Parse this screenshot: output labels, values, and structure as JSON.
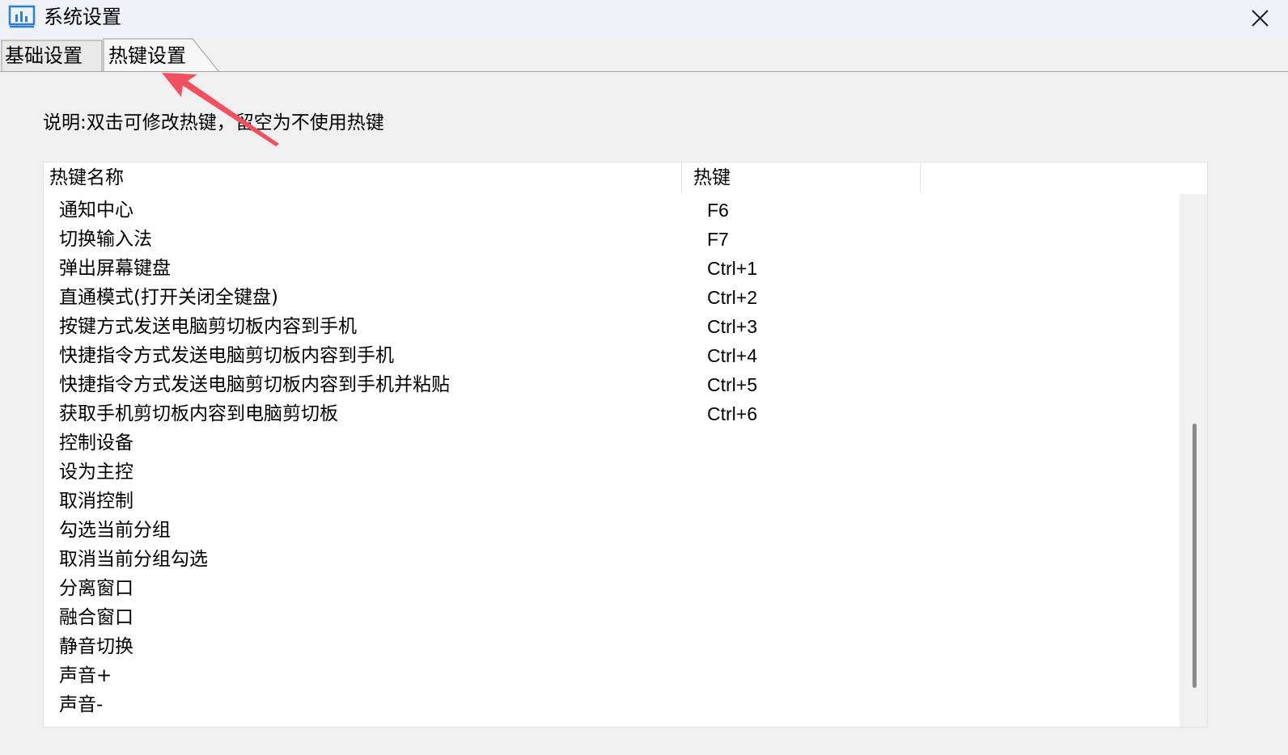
{
  "window": {
    "title": "系统设置"
  },
  "tabs": [
    {
      "label": "基础设置"
    },
    {
      "label": "热键设置"
    }
  ],
  "description": "说明:双击可修改热键，留空为不使用热键",
  "table": {
    "headers": {
      "name": "热键名称",
      "key": "热键"
    },
    "rows": [
      {
        "name": "通知中心",
        "key": "F6"
      },
      {
        "name": "切换输入法",
        "key": "F7"
      },
      {
        "name": "弹出屏幕键盘",
        "key": "Ctrl+1"
      },
      {
        "name": "直通模式(打开关闭全键盘)",
        "key": "Ctrl+2"
      },
      {
        "name": "按键方式发送电脑剪切板内容到手机",
        "key": "Ctrl+3"
      },
      {
        "name": "快捷指令方式发送电脑剪切板内容到手机",
        "key": "Ctrl+4"
      },
      {
        "name": "快捷指令方式发送电脑剪切板内容到手机并粘贴",
        "key": "Ctrl+5"
      },
      {
        "name": "获取手机剪切板内容到电脑剪切板",
        "key": "Ctrl+6"
      },
      {
        "name": "控制设备",
        "key": ""
      },
      {
        "name": "设为主控",
        "key": ""
      },
      {
        "name": "取消控制",
        "key": ""
      },
      {
        "name": "勾选当前分组",
        "key": ""
      },
      {
        "name": "取消当前分组勾选",
        "key": ""
      },
      {
        "name": "分离窗口",
        "key": ""
      },
      {
        "name": "融合窗口",
        "key": ""
      },
      {
        "name": "静音切换",
        "key": ""
      },
      {
        "name": "声音+",
        "key": ""
      },
      {
        "name": "声音-",
        "key": ""
      }
    ]
  },
  "colors": {
    "annotation_arrow": "#f0505f",
    "app_icon": "#2f7fd1"
  },
  "icons": {
    "app": "chart-icon",
    "close": "close-icon",
    "annotation": "arrow-annotation"
  }
}
